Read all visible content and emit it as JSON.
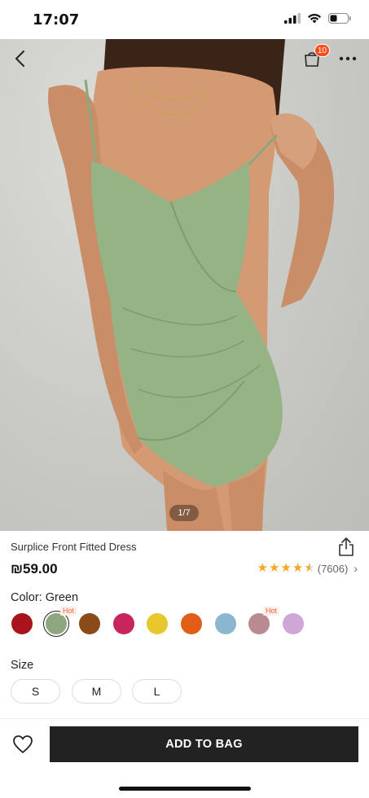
{
  "status_bar": {
    "time": "17:07"
  },
  "gallery": {
    "indicator": "1/7"
  },
  "header": {
    "bag_count": "10"
  },
  "product": {
    "title": "Surplice Front Fitted Dress",
    "price": "₪59.00",
    "rating_count": "(7606)",
    "rating_chevron": "›"
  },
  "color": {
    "label": "Color: Green",
    "hot_label": "Hot",
    "swatches": [
      {
        "name": "red",
        "hex": "#a9141c"
      },
      {
        "name": "green",
        "hex": "#8fa67f",
        "selected": true,
        "hot": true
      },
      {
        "name": "brown",
        "hex": "#8b4a1a"
      },
      {
        "name": "pink",
        "hex": "#c8245e"
      },
      {
        "name": "yellow",
        "hex": "#e8c72e"
      },
      {
        "name": "orange",
        "hex": "#e25d16"
      },
      {
        "name": "light-blue",
        "hex": "#8ab6cf"
      },
      {
        "name": "mauve",
        "hex": "#b88a92",
        "hot": true
      },
      {
        "name": "lilac",
        "hex": "#cfa6d8"
      }
    ]
  },
  "size": {
    "label": "Size",
    "options": [
      "S",
      "M",
      "L"
    ]
  },
  "footer": {
    "add_to_bag": "ADD TO BAG"
  },
  "colors": {
    "accent": "#222222",
    "badge": "#fa4d1a",
    "star": "#f5a623"
  }
}
